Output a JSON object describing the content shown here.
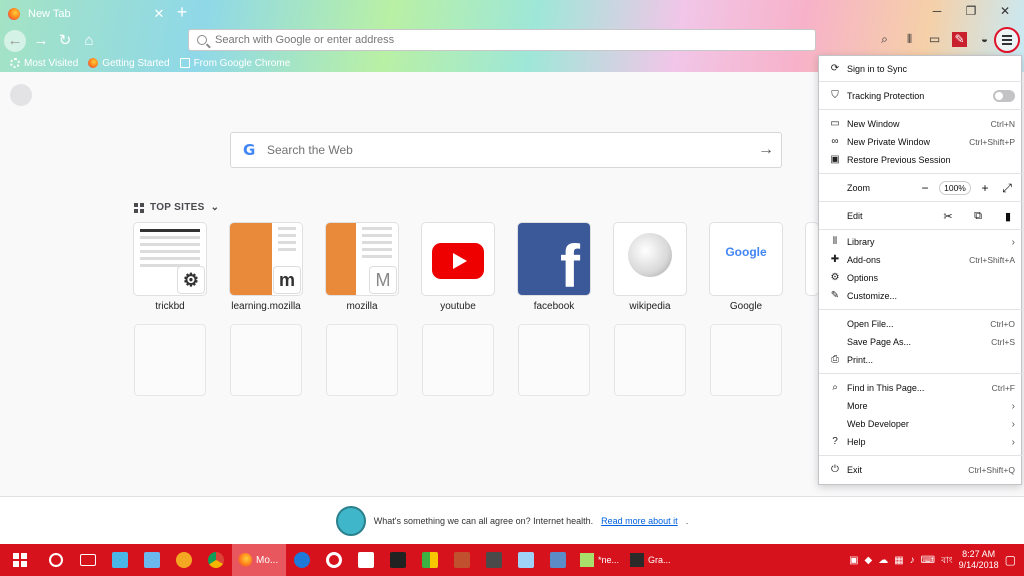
{
  "browser": {
    "tab_title": "New Tab",
    "url_placeholder": "Search with Google or enter address"
  },
  "bookmarks": [
    {
      "label": "Most Visited",
      "icon": "gear-icon"
    },
    {
      "label": "Getting Started",
      "icon": "firefox-icon"
    },
    {
      "label": "From Google Chrome",
      "icon": "folder-icon"
    }
  ],
  "newtab": {
    "search_placeholder": "Search the Web",
    "top_sites_label": "TOP SITES",
    "sites": [
      {
        "label": "trickbd"
      },
      {
        "label": "learning.mozilla"
      },
      {
        "label": "mozilla"
      },
      {
        "label": "youtube"
      },
      {
        "label": "facebook"
      },
      {
        "label": "wikipedia"
      },
      {
        "label": "Google"
      }
    ],
    "snippet_text": "What's something we can all agree on? Internet health.",
    "snippet_link": "Read more about it",
    "snippet_end": "."
  },
  "menu": {
    "sign_in": "Sign in to Sync",
    "tracking": "Tracking Protection",
    "new_window": {
      "label": "New Window",
      "key": "Ctrl+N"
    },
    "new_private": {
      "label": "New Private Window",
      "key": "Ctrl+Shift+P"
    },
    "restore": {
      "label": "Restore Previous Session"
    },
    "zoom": {
      "label": "Zoom",
      "value": "100%"
    },
    "edit": {
      "label": "Edit"
    },
    "library": {
      "label": "Library"
    },
    "addons": {
      "label": "Add-ons",
      "key": "Ctrl+Shift+A"
    },
    "options": {
      "label": "Options"
    },
    "customize": {
      "label": "Customize..."
    },
    "open_file": {
      "label": "Open File...",
      "key": "Ctrl+O"
    },
    "save_page": {
      "label": "Save Page As...",
      "key": "Ctrl+S"
    },
    "print": {
      "label": "Print..."
    },
    "find": {
      "label": "Find in This Page...",
      "key": "Ctrl+F"
    },
    "more": {
      "label": "More"
    },
    "web_dev": {
      "label": "Web Developer"
    },
    "help": {
      "label": "Help"
    },
    "exit": {
      "label": "Exit",
      "key": "Ctrl+Shift+Q"
    }
  },
  "taskbar": {
    "firefox_label": "Mo...",
    "notepad_label": "*ne...",
    "gra_label": "Gra...",
    "lang": "বাং",
    "time": "8:27 AM",
    "date": "9/14/2018"
  }
}
